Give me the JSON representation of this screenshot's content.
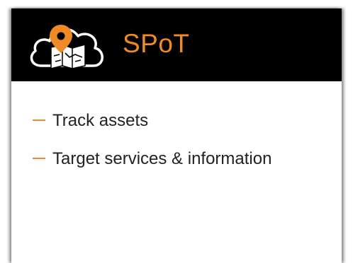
{
  "header": {
    "title": "SPoT",
    "logo_icon": "cloud-map-pin-icon",
    "background_color": "#000000",
    "accent_color": "#f08a24"
  },
  "bullets": [
    {
      "label": "Track assets"
    },
    {
      "label": "Target services & information"
    }
  ]
}
